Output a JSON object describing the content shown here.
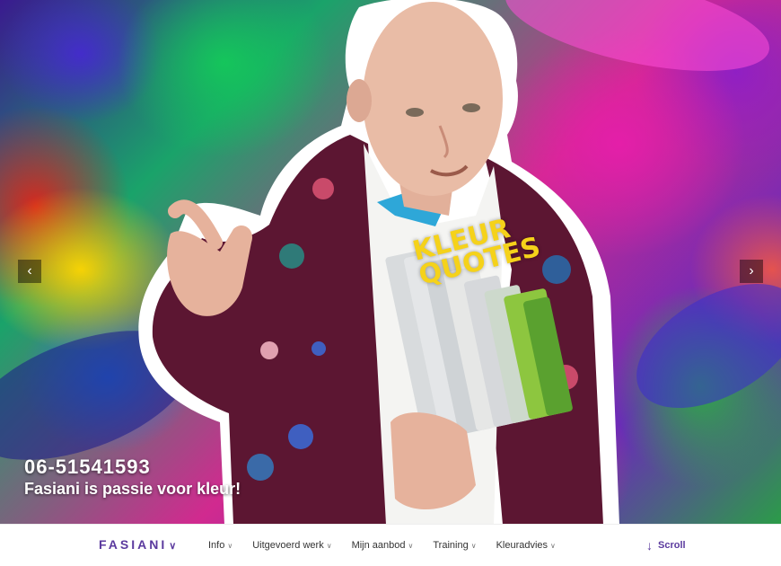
{
  "hero": {
    "phone": "06-51541593",
    "tagline": "Fasiani is passie voor kleur!",
    "badge_line1": "KLEUR",
    "badge_line2": "QUOTES",
    "prev_arrow": "‹",
    "next_arrow": "›"
  },
  "nav": {
    "brand": "FASIANI",
    "brand_chevron": "∨",
    "items": [
      {
        "label": "Info"
      },
      {
        "label": "Uitgevoerd werk"
      },
      {
        "label": "Mijn aanbod"
      },
      {
        "label": "Training"
      },
      {
        "label": "Kleuradvies"
      }
    ],
    "item_chevron": "∨",
    "scroll_label": "Scroll",
    "scroll_icon": "↓"
  },
  "colors": {
    "brand": "#5b3a9e",
    "badge_yellow": "#f5d21a"
  }
}
